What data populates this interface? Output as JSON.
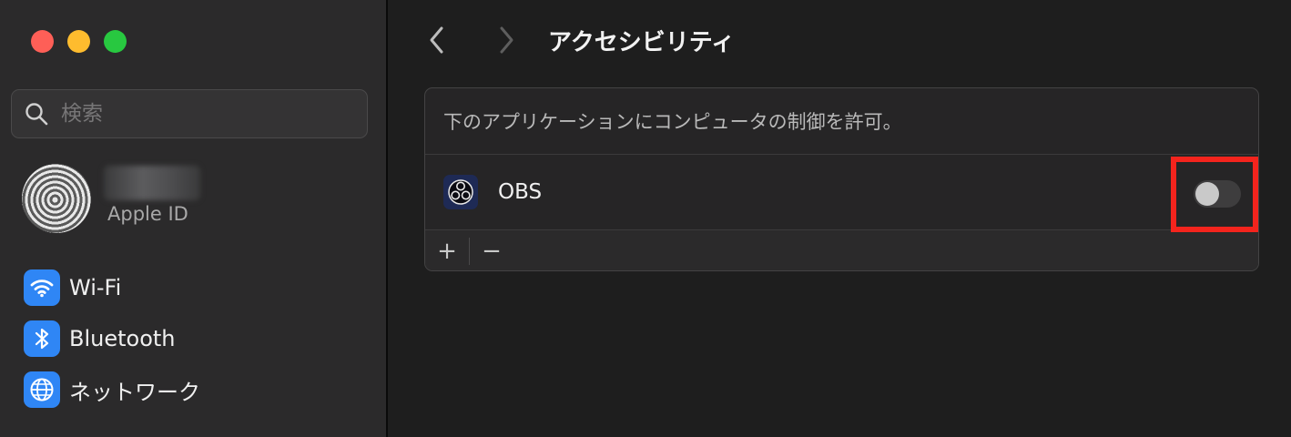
{
  "window": {
    "controls": [
      "close",
      "minimize",
      "maximize"
    ],
    "colors": {
      "close": "#fe5f57",
      "minimize": "#febc2e",
      "maximize": "#28c840"
    }
  },
  "sidebar": {
    "search": {
      "placeholder": "検索",
      "icon": "search-icon"
    },
    "account": {
      "name_blurred": true,
      "subtitle": "Apple ID"
    },
    "items": [
      {
        "label": "Wi-Fi",
        "icon": "wifi-icon",
        "icon_bg": "#2f86f5"
      },
      {
        "label": "Bluetooth",
        "icon": "bluetooth-icon",
        "icon_bg": "#2f86f5"
      },
      {
        "label": "ネットワーク",
        "icon": "globe-icon",
        "icon_bg": "#2f86f5"
      }
    ]
  },
  "toolbar": {
    "back_icon": "chevron-left-icon",
    "forward_icon": "chevron-right-icon",
    "title": "アクセシビリティ"
  },
  "panel": {
    "description": "下のアプリケーションにコンピュータの制御を許可。",
    "apps": [
      {
        "name": "OBS",
        "icon": "obs-icon",
        "enabled": false
      }
    ],
    "footer": {
      "add_label": "+",
      "remove_label": "−"
    }
  },
  "annotation": {
    "highlight_color": "#f4241d",
    "target": "OBS toggle"
  }
}
